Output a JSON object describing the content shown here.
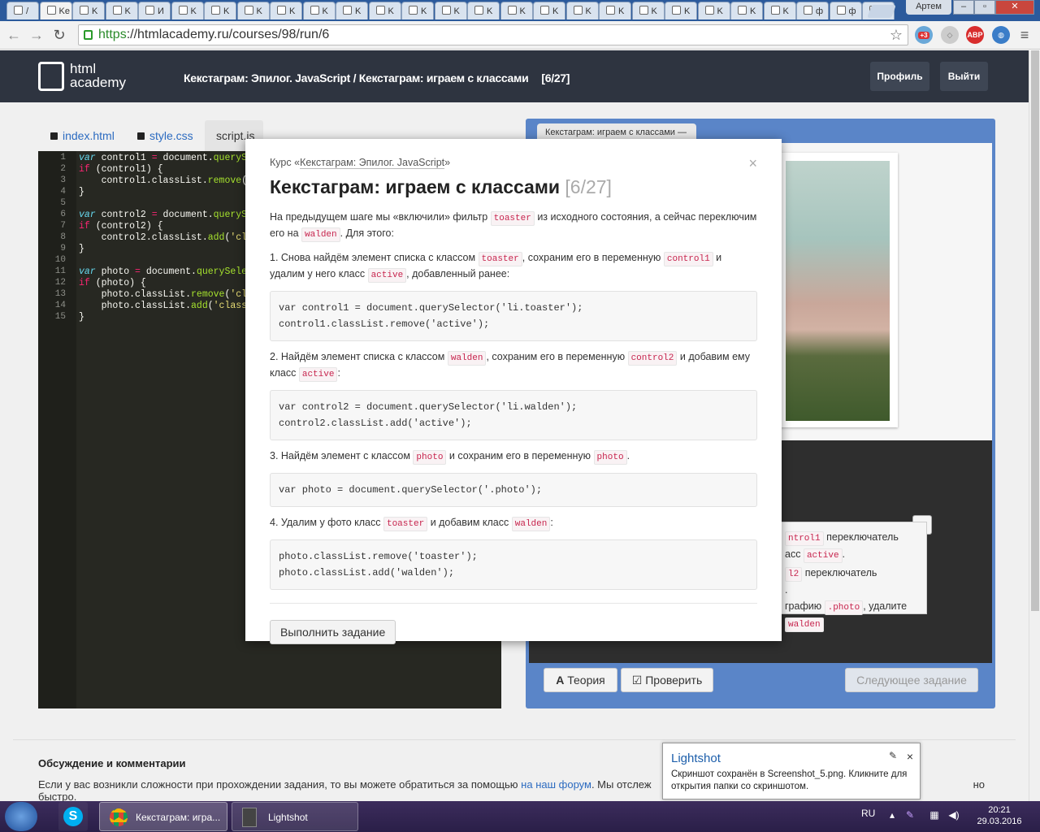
{
  "browser": {
    "tabs": [
      {
        "label": "/"
      },
      {
        "label": "Ke"
      },
      {
        "label": "K"
      },
      {
        "label": "K"
      },
      {
        "label": "И"
      },
      {
        "label": "K"
      },
      {
        "label": "K"
      },
      {
        "label": "K"
      },
      {
        "label": "K"
      },
      {
        "label": "K"
      },
      {
        "label": "K"
      },
      {
        "label": "K"
      },
      {
        "label": "K"
      },
      {
        "label": "K"
      },
      {
        "label": "K"
      },
      {
        "label": "K"
      },
      {
        "label": "K"
      },
      {
        "label": "K"
      },
      {
        "label": "K"
      },
      {
        "label": "K"
      },
      {
        "label": "K"
      },
      {
        "label": "K"
      },
      {
        "label": "K"
      },
      {
        "label": "K"
      },
      {
        "label": "ф"
      },
      {
        "label": "ф"
      },
      {
        "label": "Г"
      }
    ],
    "user": "Артем",
    "url_scheme": "https",
    "url_rest": "://htmlacademy.ru/courses/98/run/6",
    "ext_badge": "+3",
    "abp": "ABP"
  },
  "site": {
    "logo_line1": "html",
    "logo_line2": "academy",
    "crumb_course": "Кекстаграм: Эпилог. JavaScript",
    "crumb_sep": " / ",
    "crumb_task": "Кекстаграм: играем с классами",
    "crumb_count": "[6/27]",
    "profile": "Профиль",
    "logout": "Выйти"
  },
  "editor": {
    "tabs": [
      "index.html",
      "style.css",
      "script.js"
    ],
    "lines": [
      "1",
      "2",
      "3",
      "4",
      "5",
      "6",
      "7",
      "8",
      "9",
      "10",
      "11",
      "12",
      "13",
      "14",
      "15"
    ]
  },
  "preview": {
    "tab": "Кекстаграм: играем с классами —",
    "task1_a": "ntrol1",
    "task1_b": "переключатель",
    "task1_c": "асс",
    "task1_d": "active",
    "task2_a": "l2",
    "task2_b": "переключатель",
    "task3_a": "графию",
    "task3_b": ".photo",
    "task3_c": ", удалите",
    "task3_d": "walden",
    "up": "↑",
    "theory": "Теория",
    "check": "Проверить",
    "next": "Следующее задание"
  },
  "modal": {
    "course_label": "Курс «",
    "course_link": "Кекстаграм: Эпилог. JavaScript",
    "course_end": "»",
    "close": "×",
    "title": "Кекстаграм: играем с классами",
    "count": "[6/27]",
    "intro_a": "На предыдущем шаге мы «включили» фильтр",
    "intro_tag1": "toaster",
    "intro_b": "из исходного состояния, а сейчас переключим его на",
    "intro_tag2": "walden",
    "intro_c": ". Для этого:",
    "s1_a": "1. Снова найдём элемент списка с классом",
    "s1_t1": "toaster",
    "s1_b": ", сохраним его в переменную",
    "s1_t2": "control1",
    "s1_c": "и удалим у него класс",
    "s1_t3": "active",
    "s1_d": ", добавленный ранее:",
    "code1": "var control1 = document.querySelector('li.toaster');\ncontrol1.classList.remove('active');",
    "s2_a": "2. Найдём элемент списка с классом",
    "s2_t1": "walden",
    "s2_b": ", сохраним его в переменную",
    "s2_t2": "control2",
    "s2_c": "и добавим ему класс",
    "s2_t3": "active",
    "s2_d": ":",
    "code2": "var control2 = document.querySelector('li.walden');\ncontrol2.classList.add('active');",
    "s3_a": "3. Найдём элемент с классом",
    "s3_t1": "photo",
    "s3_b": "и сохраним его в переменную",
    "s3_t2": "photo",
    "s3_c": ".",
    "code3": "var photo = document.querySelector('.photo');",
    "s4_a": "4. Удалим у фото класс",
    "s4_t1": "toaster",
    "s4_b": "и добавим класс",
    "s4_t2": "walden",
    "s4_c": ":",
    "code4": "photo.classList.remove('toaster');\nphoto.classList.add('walden');",
    "run": "Выполнить задание"
  },
  "discussion": {
    "title": "Обсуждение и комментарии",
    "text_a": "Если у вас возникли сложности при прохождении задания, то вы можете обратиться за помощью",
    "link": "на наш форум",
    "text_b": ". Мы отслеж",
    "text_c": "но быстро."
  },
  "lightshot": {
    "title": "Lightshot",
    "msg": "Скриншот сохранён в Screenshot_5.png. Кликните для открытия папки со скриншотом.",
    "close": "×",
    "pin": "✎"
  },
  "taskbar": {
    "chrome_label": "Кекстаграм: игра...",
    "lightshot_label": "Lightshot",
    "lang": "RU",
    "time": "20:21",
    "date": "29.03.2016"
  }
}
